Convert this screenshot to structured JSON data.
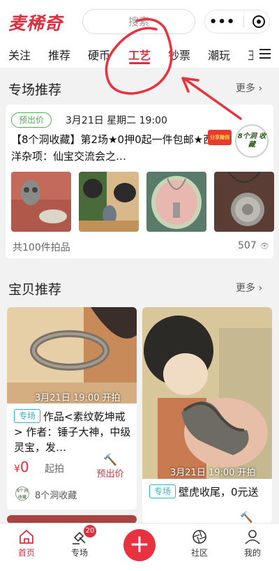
{
  "header": {
    "logo": "麦稀奇",
    "search_placeholder": "搜索",
    "capsule_more": "•••"
  },
  "tabs": [
    {
      "label": "关注",
      "active": false
    },
    {
      "label": "推荐",
      "active": false
    },
    {
      "label": "硬币",
      "active": false
    },
    {
      "label": "工艺",
      "active": true
    },
    {
      "label": "钞票",
      "active": false
    },
    {
      "label": "潮玩",
      "active": false
    },
    {
      "label": "玉",
      "active": false
    }
  ],
  "special": {
    "title": "专场推荐",
    "more": "更多 ›",
    "card": {
      "badge": "预出价",
      "date": "3月21日 星期二 19:00",
      "title": "【8个洞收藏】第2场★0押0起一件包邮★西洋杂项：仙宝交流会之…",
      "share_badge": "分享赚佣",
      "shop_logo": "8个洞 收藏",
      "lots": "共100件拍品",
      "views": "507"
    }
  },
  "products": {
    "title": "宝贝推荐",
    "more": "更多 ›",
    "items": [
      {
        "time": "3月21日 19:00 开拍",
        "tag": "专场",
        "title": "作品<素纹乾坤戒> 作者：锤子大神，中级灵宝，发…",
        "currency": "¥",
        "price": "0",
        "qipai": "起拍",
        "action": "预出价",
        "shop": "8个洞收藏",
        "shop_logo": "8个洞 收藏"
      },
      {
        "time": "3月21日 19:00 开拍",
        "tag": "专场",
        "title": "壁虎收尾，0元送"
      }
    ]
  },
  "bottom_nav": {
    "home": "首页",
    "special": "专场",
    "special_badge": "20",
    "community": "社区",
    "mine": "我的"
  },
  "colors": {
    "accent": "#e02e3c",
    "green": "#4caf50",
    "cyan": "#29b6c8"
  }
}
